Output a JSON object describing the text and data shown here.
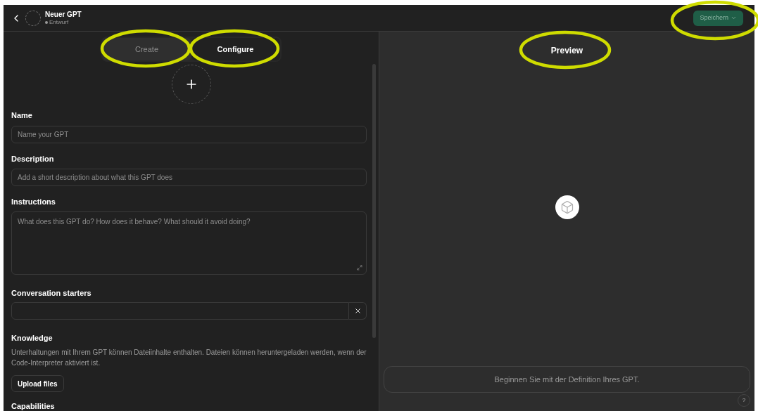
{
  "header": {
    "title": "Neuer GPT",
    "status": "Entwurf",
    "save_button": "Speichern"
  },
  "tabs": [
    {
      "label": "Create",
      "selected": false
    },
    {
      "label": "Configure",
      "selected": true
    }
  ],
  "form": {
    "fields": [
      {
        "kind": "input",
        "label": "Name",
        "placeholder": "Name your GPT"
      },
      {
        "kind": "input",
        "label": "Description",
        "placeholder": "Add a short description about what this GPT does"
      },
      {
        "kind": "textarea",
        "label": "Instructions",
        "placeholder": "What does this GPT do? How does it behave? What should it avoid doing?"
      },
      {
        "kind": "starter",
        "label": "Conversation starters"
      }
    ],
    "knowledge": {
      "label": "Knowledge",
      "text": "Unterhaltungen mit Ihrem GPT können Dateiinhalte enthalten. Dateien können heruntergeladen werden, wenn der Code-Interpreter aktiviert ist.",
      "button": "Upload files"
    },
    "capabilities_label": "Capabilities"
  },
  "preview": {
    "title": "Preview",
    "placeholder": "Beginnen Sie mit der Definition Ihres GPT.",
    "help": "?"
  }
}
